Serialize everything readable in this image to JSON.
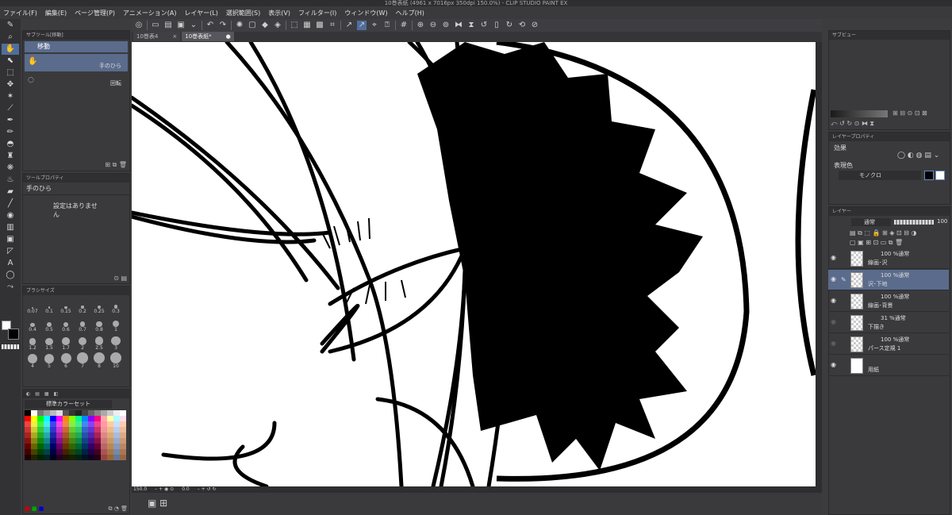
{
  "window": {
    "title": "10巻表紙 (4961 x 7016px 350dpi 150.0%) - CLIP STUDIO PAINT EX"
  },
  "menu": [
    "ファイル(F)",
    "編集(E)",
    "ページ管理(P)",
    "アニメーション(A)",
    "レイヤー(L)",
    "選択範囲(S)",
    "表示(V)",
    "フィルター(I)",
    "ウィンドウ(W)",
    "ヘルプ(H)"
  ],
  "tabs": [
    {
      "label": "10巻表4",
      "close": "×"
    },
    {
      "label": "10巻表紙*",
      "close": "●"
    }
  ],
  "subtool": {
    "header": "サブツール[移動]",
    "group": "移動",
    "items": [
      "手のひら",
      "回転"
    ]
  },
  "toolprop": {
    "header": "ツールプロパティ",
    "name": "手のひら",
    "empty": "設定はありません"
  },
  "brushsize": {
    "header": "ブラシサイズ",
    "sizes": [
      "0.07",
      "0.1",
      "0.15",
      "0.2",
      "0.25",
      "0.3",
      "0.4",
      "0.5",
      "0.6",
      "0.7",
      "0.8",
      "1",
      "1.2",
      "1.5",
      "1.7",
      "2",
      "2.5",
      "3",
      "4",
      "5",
      "6",
      "7",
      "8",
      "10"
    ]
  },
  "colorset": {
    "name": "標準カラーセット"
  },
  "navigator": {
    "header": "サブビュー"
  },
  "layerprop": {
    "header": "レイヤープロパティ",
    "effect": "効果",
    "expression": "表現色",
    "mode": "モノクロ"
  },
  "layerpanel": {
    "header": "レイヤー",
    "blend": "通常",
    "opacity": "100"
  },
  "layers": [
    {
      "top": "100 %通常",
      "name": "線画･沢",
      "selected": false
    },
    {
      "top": "100 %通常",
      "name": "沢･下地",
      "selected": true
    },
    {
      "top": "100 %通常",
      "name": "線画･背景",
      "selected": false
    },
    {
      "top": "31 %通常",
      "name": "下描き",
      "selected": false
    },
    {
      "top": "100 %通常",
      "name": "パース定規 1",
      "selected": false
    },
    {
      "top": "",
      "name": "用紙",
      "selected": false
    }
  ],
  "status": {
    "zoom": "150.0",
    "angle": "0.0"
  },
  "colors": {
    "accent": "#4f6e9c",
    "panel": "#3a3a3d",
    "canvas": "#ffffff"
  }
}
